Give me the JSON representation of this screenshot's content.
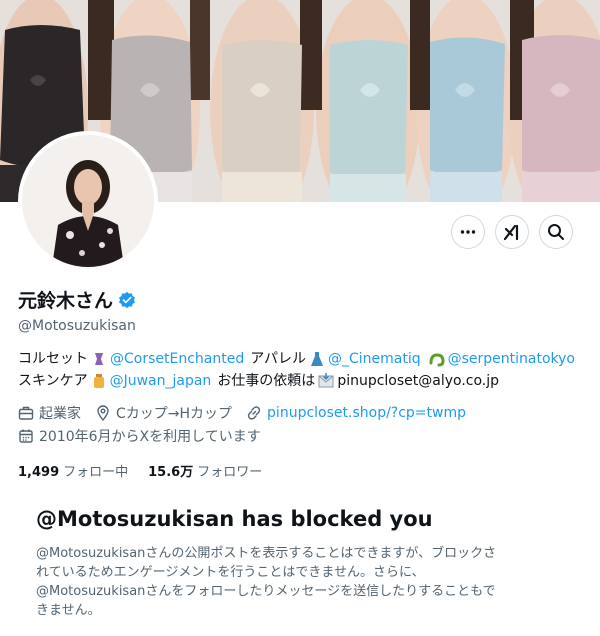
{
  "profile": {
    "display_name": "元鈴木さん",
    "handle": "@Motosuzukisan",
    "verified_icon": "verified-badge-icon",
    "verified_color": "#1d9bf0"
  },
  "actions": {
    "more_icon": "more-horizontal-icon",
    "grok_icon": "grok-icon",
    "search_icon": "search-icon"
  },
  "bio": {
    "prefix_1": "コルセット",
    "mention_1": "@CorsetEnchanted",
    "text_2": "アパレル",
    "mention_2": "@_Cinematiq",
    "mention_3": "@serpentinatokyo",
    "prefix_2": "スキンケア",
    "mention_4": "@Juwan_japan",
    "text_4": "お仕事の依頼は",
    "email": "pinupcloset@alyo.co.jp"
  },
  "meta": {
    "occupation": "起業家",
    "location": "Cカップ→Hカップ",
    "website": "pinupcloset.shop/?cp=twmp",
    "joined": "2010年6月からXを利用しています"
  },
  "stats": {
    "following_count": "1,499",
    "following_label": "フォロー中",
    "followers_count": "15.6万",
    "followers_label": "フォロワー"
  },
  "blocked": {
    "title": "@Motosuzukisan has blocked you",
    "line_1": "@Motosuzukisanさんの公開ポストを表示することはできますが、ブロックさ",
    "line_2": "れているためエンゲージメントを行うことはできません。さらに、",
    "line_3": "@Motosuzukisanさんをフォローしたりメッセージを送信したりすることもで",
    "line_4": "きません。"
  },
  "colors": {
    "link": "#1d9bf0",
    "text_primary": "#0f1419",
    "text_secondary": "#536471",
    "border": "#cfd9de"
  }
}
